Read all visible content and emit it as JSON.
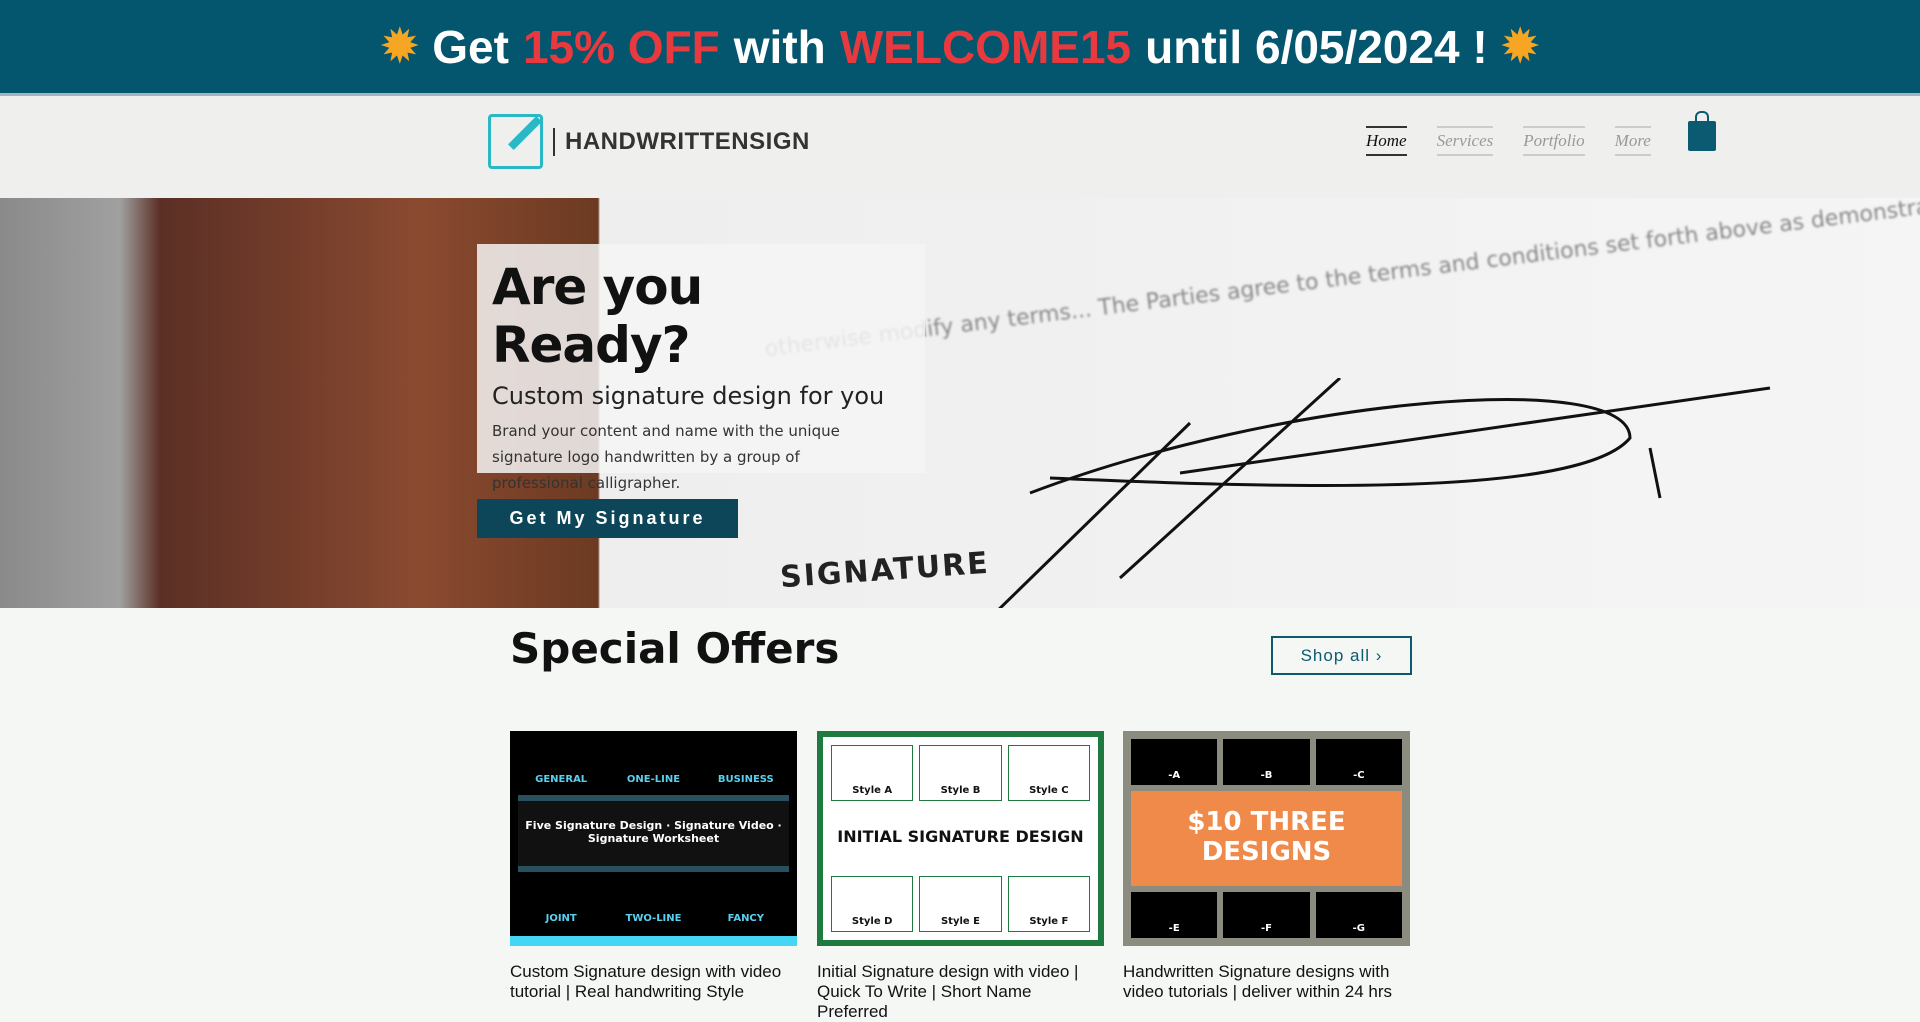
{
  "banner": {
    "prefix": "Get",
    "discount": "15% OFF",
    "mid": "with",
    "code": "WELCOME15",
    "suffix": "until 6/05/2024 !",
    "icon": "sun-icon",
    "accent": "#e83a3e",
    "background": "#04566f"
  },
  "nav": {
    "brand": "HANDWRITTENSIGN",
    "items": [
      "Home",
      "Services",
      "Portfolio",
      "More"
    ],
    "active": "Home",
    "cart_icon": "shopping-bag-icon"
  },
  "hero": {
    "title": "Are you Ready?",
    "subtitle": "Custom signature design for you",
    "body": "Brand your content and name with the unique signature logo handwritten by a group of professional calligrapher.",
    "cta": "Get My Signature",
    "bg_text": "otherwise modify any terms... The Parties agree to the terms and conditions set forth above as demonstrated by their",
    "signature_word": "SIGNATURE"
  },
  "offers": {
    "title": "Special Offers",
    "shop_all": "Shop all ›",
    "products": [
      {
        "title": "Custom Signature design with video tutorial | Real handwriting Style",
        "tiles": [
          "GENERAL",
          "ONE-LINE",
          "BUSINESS",
          "Five Signature Design · Signature Video · Signature Worksheet",
          "JOINT",
          "TWO-LINE",
          "FANCY"
        ]
      },
      {
        "title": "Initial Signature design with video | Quick To Write | Short Name Preferred",
        "tiles": [
          "Style A",
          "Style B",
          "Style C",
          "INITIAL SIGNATURE DESIGN",
          "Style D",
          "Style E",
          "Style F"
        ]
      },
      {
        "title": "Handwritten Signature designs with video tutorials | deliver within 24 hrs",
        "tiles": [
          "-A",
          "-B",
          "-C",
          "$10 THREE DESIGNS",
          "-E",
          "-F",
          "-G"
        ]
      }
    ]
  }
}
